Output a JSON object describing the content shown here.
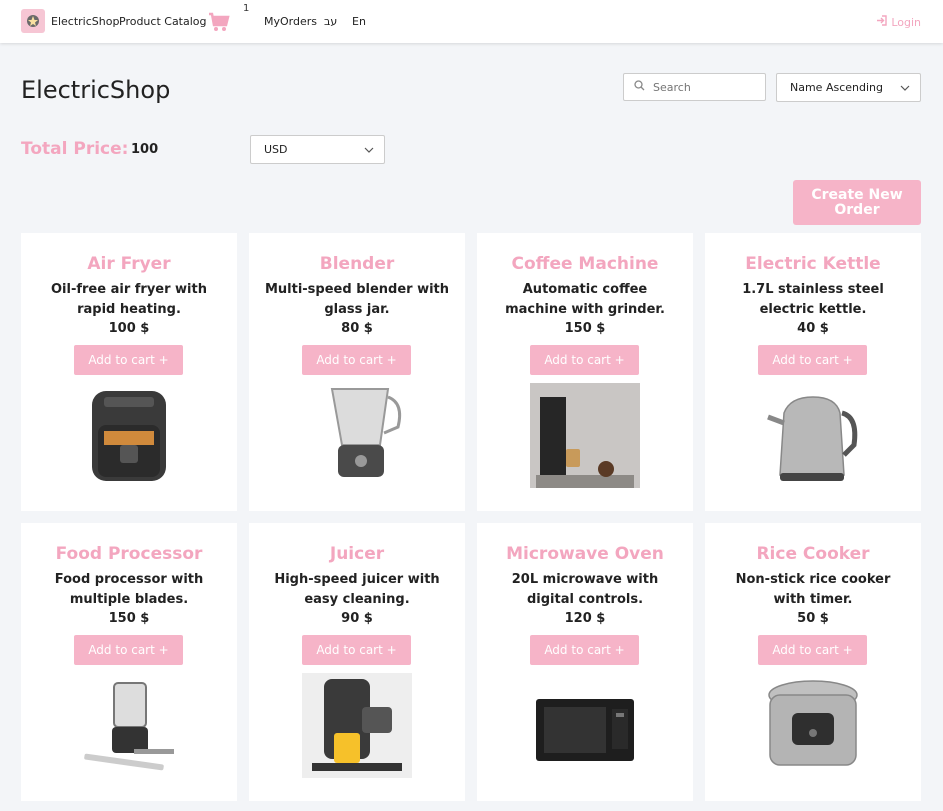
{
  "navbar": {
    "brand": "ElectricShop",
    "catalog": "Product Catalog",
    "cart_count": "1",
    "orders": "MyOrders",
    "lang_he": "עב",
    "lang_en": "En",
    "login": "Login"
  },
  "page": {
    "title": "ElectricShop",
    "search_placeholder": "Search",
    "sort_value": "Name Ascending",
    "total_label": "Total Price:",
    "total_value": "100",
    "currency": "USD",
    "create_order": "Create New Order"
  },
  "colors": {
    "accent": "#f3a6bf",
    "button": "#f6b4c8",
    "background": "#f3f5f8"
  },
  "products": [
    {
      "name": "Air Fryer",
      "description": "Oil-free air fryer with rapid heating.",
      "price": "100 $",
      "button": "Add to cart +",
      "image": "air-fryer-image"
    },
    {
      "name": "Blender",
      "description": "Multi-speed blender with glass jar.",
      "price": "80 $",
      "button": "Add to cart +",
      "image": "blender-image"
    },
    {
      "name": "Coffee Machine",
      "description": "Automatic coffee machine with grinder.",
      "price": "150 $",
      "button": "Add to cart +",
      "image": "coffee-machine-image"
    },
    {
      "name": "Electric Kettle",
      "description": "1.7L stainless steel electric kettle.",
      "price": "40 $",
      "button": "Add to cart +",
      "image": "electric-kettle-image"
    },
    {
      "name": "Food Processor",
      "description": "Food processor with multiple blades.",
      "price": "150 $",
      "button": "Add to cart +",
      "image": "food-processor-image"
    },
    {
      "name": "Juicer",
      "description": "High-speed juicer with easy cleaning.",
      "price": "90 $",
      "button": "Add to cart +",
      "image": "juicer-image"
    },
    {
      "name": "Microwave Oven",
      "description": "20L microwave with digital controls.",
      "price": "120 $",
      "button": "Add to cart +",
      "image": "microwave-image"
    },
    {
      "name": "Rice Cooker",
      "description": "Non-stick rice cooker with timer.",
      "price": "50 $",
      "button": "Add to cart +",
      "image": "rice-cooker-image"
    }
  ]
}
